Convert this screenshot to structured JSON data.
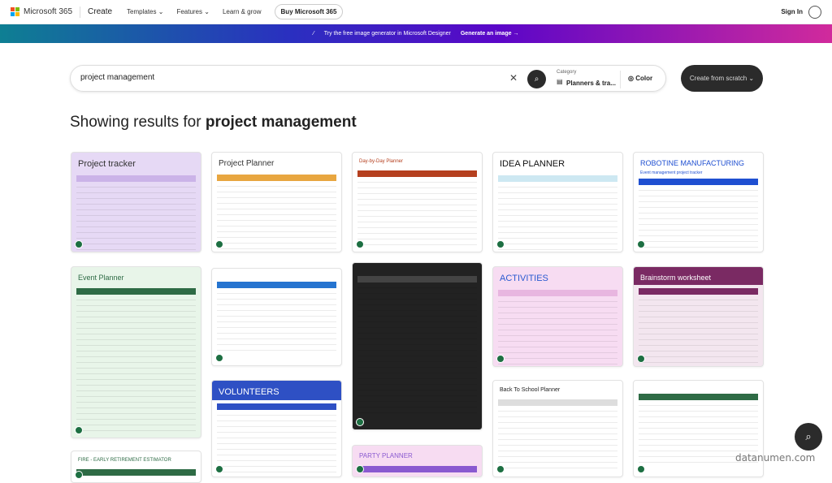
{
  "header": {
    "brand": "Microsoft 365",
    "app": "Create",
    "nav": [
      "Templates ⌄",
      "Features ⌄",
      "Learn & grow"
    ],
    "buy": "Buy Microsoft 365",
    "signin": "Sign In"
  },
  "banner": {
    "text": "Try the free image generator in Microsoft Designer",
    "link": "Generate an image →"
  },
  "search": {
    "value": "project management",
    "category_label": "Category",
    "category_value": "Planners & tra...",
    "color": "Color",
    "create": "Create from scratch ⌄"
  },
  "results": {
    "prefix": "Showing results for ",
    "query": "project management"
  },
  "colors": {
    "excel": "#1d6f42",
    "banner_start": "#0e7f93",
    "banner_end": "#d12a9c"
  },
  "templates": [
    {
      "title": "Project tracker"
    },
    {
      "title": "Project Planner"
    },
    {
      "title": "Day-by-Day Planner"
    },
    {
      "title": "IDEA PLANNER"
    },
    {
      "title": "ROBOTINE MANUFACTURING",
      "subtitle": "Event management project tracker"
    },
    {
      "title": "Event Planner"
    },
    {
      "title": ""
    },
    {
      "title": ""
    },
    {
      "title": "ACTIVITIES"
    },
    {
      "title": "Brainstorm worksheet"
    },
    {
      "title": "VOLUNTEERS"
    },
    {
      "title": "Back To School Planner"
    },
    {
      "title": ""
    },
    {
      "title": "FIRE - EARLY RETIREMENT ESTIMATOR"
    },
    {
      "title": "PARTY PLANNER"
    }
  ],
  "watermark": "datanumen.com"
}
